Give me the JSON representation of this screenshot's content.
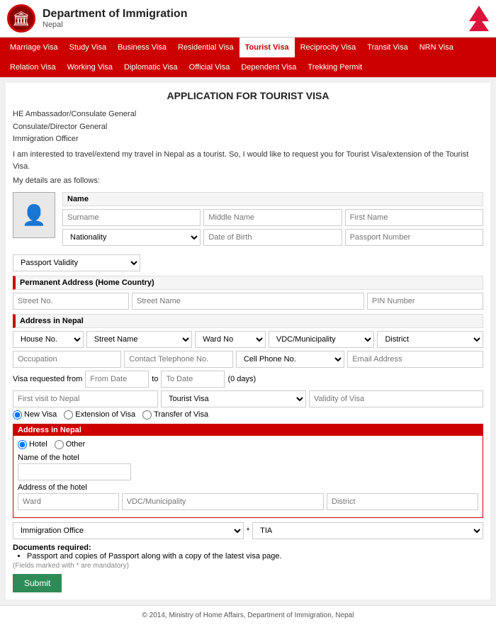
{
  "header": {
    "dept_name": "Department of Immigration",
    "dept_sub": "Nepal",
    "logo_char": "🏛"
  },
  "nav": {
    "items": [
      {
        "label": "Marriage Visa",
        "active": false
      },
      {
        "label": "Study Visa",
        "active": false
      },
      {
        "label": "Business Visa",
        "active": false
      },
      {
        "label": "Residential Visa",
        "active": false
      },
      {
        "label": "Tourist Visa",
        "active": true
      },
      {
        "label": "Reciprocity Visa",
        "active": false
      },
      {
        "label": "Transit Visa",
        "active": false
      },
      {
        "label": "NRN Visa",
        "active": false
      },
      {
        "label": "Relation Visa",
        "active": false
      },
      {
        "label": "Working Visa",
        "active": false
      },
      {
        "label": "Diplomatic Visa",
        "active": false
      },
      {
        "label": "Official Visa",
        "active": false
      },
      {
        "label": "Dependent Visa",
        "active": false
      },
      {
        "label": "Trekking Permit",
        "active": false
      }
    ]
  },
  "page": {
    "title": "APPLICATION FOR TOURIST VISA",
    "intro_line1": "HE Ambassador/Consulate General",
    "intro_line2": "Consulate/Director General",
    "intro_line3": "Immigration Officer",
    "intro_body": "I am interested to travel/extend my travel in Nepal as a tourist. So, I would like to request you for Tourist Visa/extension of the Tourist Visa.",
    "details_label": "My details are as follows:"
  },
  "form": {
    "name_section_label": "Name",
    "surname_placeholder": "Surname",
    "middle_name_placeholder": "Middle Name",
    "first_name_placeholder": "First Name",
    "nationality_placeholder": "Nationality",
    "dob_placeholder": "Date of Birth",
    "passport_no_placeholder": "Passport Number",
    "passport_validity_placeholder": "Passport Validity",
    "permanent_address_label": "Permanent Address (Home Country)",
    "street_no_placeholder": "Street No.",
    "street_name_placeholder": "Street Name",
    "pin_number_placeholder": "PIN Number",
    "address_nepal_label": "Address in Nepal",
    "house_no_placeholder": "House No.",
    "street_name2_placeholder": "Street Name",
    "ward_no_placeholder": "Ward No",
    "vdc_municipality_placeholder": "VDC/Municipality",
    "district_placeholder": "District",
    "occupation_placeholder": "Occupation",
    "contact_tel_placeholder": "Contact Telephone No.",
    "cell_phone_placeholder": "Cell Phone No.",
    "email_placeholder": "Email Address",
    "visa_from_label": "Visa requested from",
    "to_label": "to",
    "from_date_placeholder": "From Date",
    "to_date_placeholder": "To Date",
    "days_text": "(0 days)",
    "first_visit_placeholder": "First visit to Nepal",
    "visa_type_label": "Tourist Visa",
    "validity_placeholder": "Validity of Visa",
    "new_visa_label": "New Visa",
    "extension_label": "Extension of Visa",
    "transfer_label": "Transfer of Visa",
    "address_nepal_box_label": "Address in Nepal",
    "hotel_label": "Hotel",
    "other_label": "Other",
    "hotel_name_label": "Name of the hotel",
    "hotel_address_label": "Address of the hotel",
    "ward_placeholder": "Ward",
    "vdc2_placeholder": "VDC/Municipality",
    "district2_placeholder": "District",
    "immigration_office_label": "Immigration Office",
    "tia_label": "TIA",
    "docs_title": "Documents required:",
    "docs_items": [
      "Passport and copies of Passport along with a copy of the latest visa page."
    ],
    "fields_note": "(Fields marked with * are mandatory)",
    "submit_label": "Submit"
  },
  "footer": {
    "text": "© 2014, Ministry of Home Affairs, Department of Immigration, Nepal"
  }
}
